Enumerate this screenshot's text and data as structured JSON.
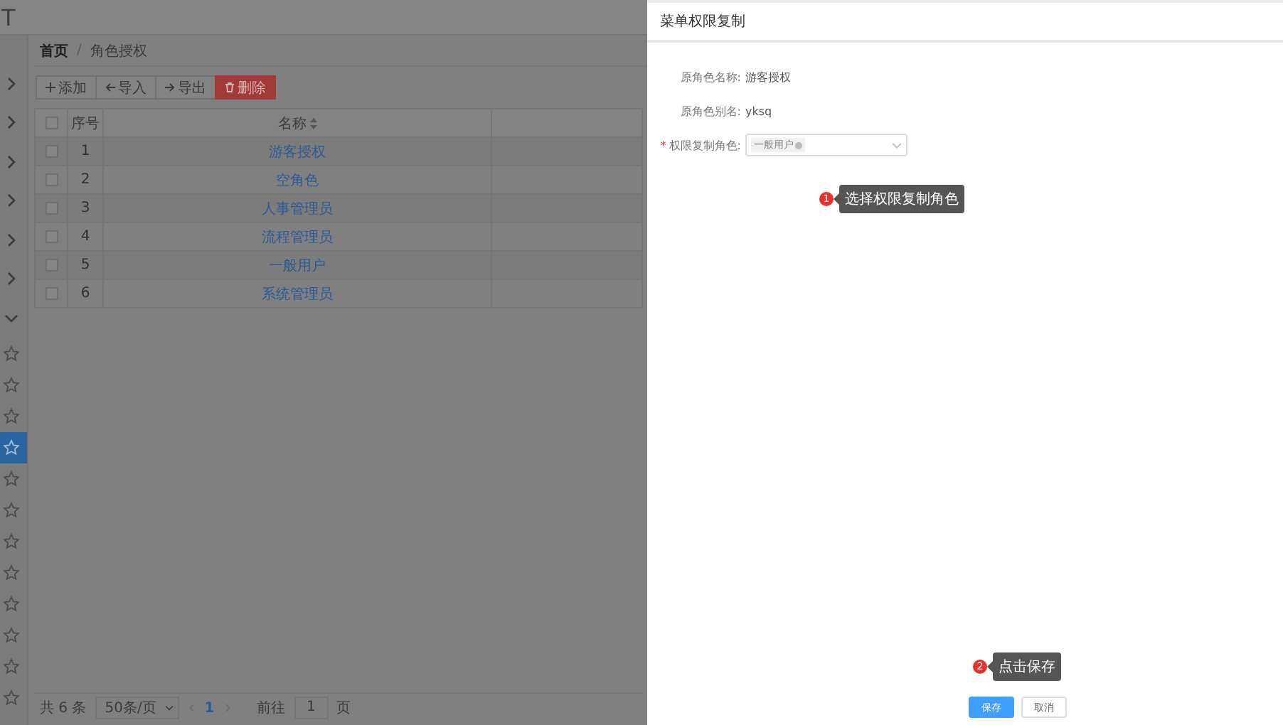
{
  "top_bar": {
    "logo": "T"
  },
  "sidebar": {
    "groups": [
      {
        "expanded": false
      },
      {
        "expanded": false
      },
      {
        "expanded": false
      },
      {
        "expanded": false
      },
      {
        "expanded": false
      },
      {
        "expanded": false
      },
      {
        "expanded": true
      }
    ],
    "items": [
      {
        "selected": false
      },
      {
        "selected": false
      },
      {
        "selected": false
      },
      {
        "selected": true
      },
      {
        "selected": false
      },
      {
        "selected": false
      },
      {
        "selected": false
      },
      {
        "selected": false
      },
      {
        "selected": false
      },
      {
        "selected": false
      },
      {
        "selected": false
      },
      {
        "selected": false
      }
    ]
  },
  "breadcrumb": {
    "items": [
      "首页",
      "角色授权"
    ],
    "separator": "/"
  },
  "toolbar": [
    {
      "label": "添加",
      "kind": "add"
    },
    {
      "label": "导入",
      "kind": "import"
    },
    {
      "label": "导出",
      "kind": "export"
    },
    {
      "label": "删除",
      "kind": "delete"
    }
  ],
  "table": {
    "all_checked": false,
    "columns": [
      "序号",
      "名称"
    ],
    "rows": [
      {
        "index": "1",
        "name": "游客授权",
        "checked": false
      },
      {
        "index": "2",
        "name": "空角色",
        "checked": false
      },
      {
        "index": "3",
        "name": "人事管理员",
        "checked": false
      },
      {
        "index": "4",
        "name": "流程管理员",
        "checked": false
      },
      {
        "index": "5",
        "name": "一般用户",
        "checked": false
      },
      {
        "index": "6",
        "name": "系统管理员",
        "checked": false
      }
    ]
  },
  "pagination": {
    "total": "共 6 条",
    "page_size": "50条/页",
    "pages": [
      {
        "label": "1",
        "selected": true
      }
    ],
    "goto_label": "前往",
    "goto_value": "1",
    "goto_suffix": "页"
  },
  "drawer": {
    "title": "菜单权限复制",
    "required_mark": "*",
    "fields": [
      {
        "label": "原角色名称:",
        "kind": "text",
        "required": false,
        "value": "游客授权"
      },
      {
        "label": "原角色别名:",
        "kind": "text",
        "required": false,
        "value": "yksq"
      },
      {
        "label": "权限复制角色:",
        "kind": "select",
        "required": true,
        "tags": [
          "一般用户"
        ]
      }
    ],
    "buttons": [
      {
        "label": "保存",
        "kind": "primary"
      },
      {
        "label": "取消",
        "kind": "default"
      }
    ]
  },
  "guide_steps": [
    {
      "number": "1",
      "text": "选择权限复制角色"
    },
    {
      "number": "2",
      "text": "点击保存"
    }
  ]
}
